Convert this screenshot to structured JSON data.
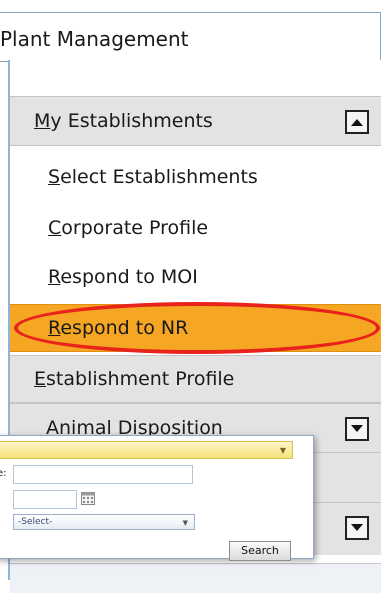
{
  "header": {
    "title": "Plant Management"
  },
  "sidebar": {
    "my_establishments": {
      "label_prefix": "M",
      "label_rest": "y Establishments",
      "items": [
        {
          "underline": "S",
          "rest": "elect Establishments"
        },
        {
          "underline": "C",
          "rest": "orporate Profile"
        },
        {
          "underline": "R",
          "rest": "espond to MOI"
        },
        {
          "underline": "R",
          "rest": "espond to NR"
        }
      ]
    },
    "establishment_profile": {
      "underline": "E",
      "rest": "stablishment Profile"
    },
    "animal_disposition": {
      "label": "Animal Disposition"
    }
  },
  "popup": {
    "field_label": "e:",
    "select_value": "-Select-",
    "search_label": "Search"
  },
  "colors": {
    "highlight": "#f5a623",
    "annotation_ring": "#e8231b",
    "header_bg": "#e3e3e3"
  },
  "icons": [
    "chevron-up-icon",
    "chevron-down-icon",
    "calendar-icon",
    "dropdown-caret-icon"
  ]
}
